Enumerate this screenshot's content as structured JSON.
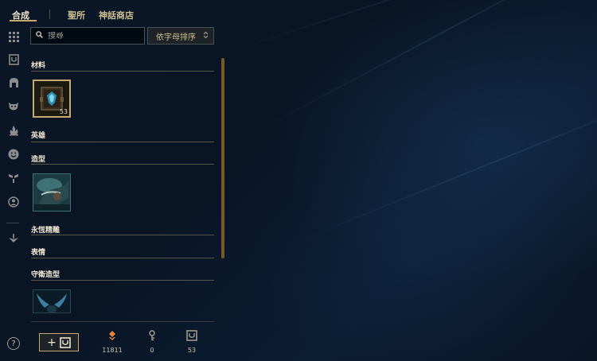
{
  "nav": {
    "tabs": [
      {
        "label": "合成",
        "active": true
      },
      {
        "label": "聖所",
        "active": false
      },
      {
        "label": "神話商店",
        "active": false
      }
    ]
  },
  "sidebar": {
    "icons": [
      "grid-icon",
      "loot-chest-icon",
      "helmet-icon",
      "mask-icon",
      "flame-icon",
      "smiley-icon",
      "ward-icon",
      "profile-icon",
      "chroma-icon"
    ]
  },
  "search": {
    "placeholder": "搜尋",
    "value": ""
  },
  "sort": {
    "label": "依字母排序"
  },
  "sections": {
    "materials": {
      "title": "材料",
      "count": "53"
    },
    "champions": {
      "title": "英雄"
    },
    "skins": {
      "title": "造型"
    },
    "eternals": {
      "title": "永恆精雕"
    },
    "emotes": {
      "title": "表情"
    },
    "ward_skins": {
      "title": "守衛造型"
    }
  },
  "currencies": {
    "orange_essence": "11811",
    "keys": "0",
    "chests": "53"
  },
  "colors": {
    "gold": "#c8aa6e",
    "orange_essence": "#e8843a",
    "text_light": "#f0e6d2"
  }
}
